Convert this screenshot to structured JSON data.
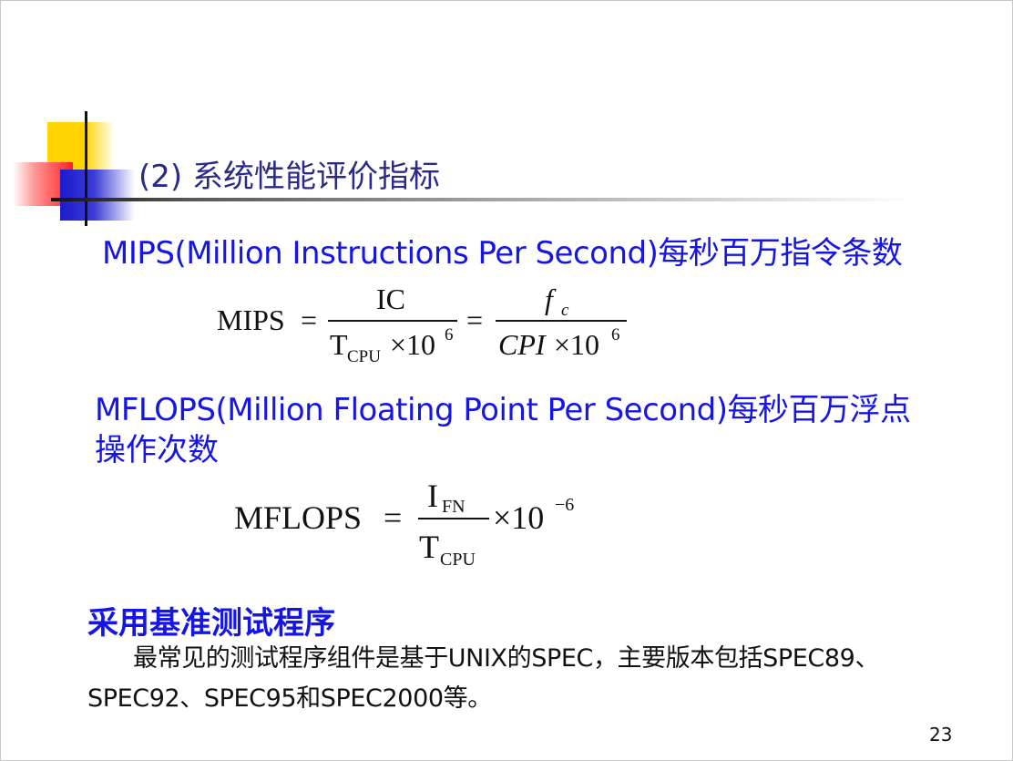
{
  "slide": {
    "title": "(2) 系统性能评价指标",
    "mips_heading": "MIPS(Million Instructions Per Second)每秒百万指令条数",
    "mflops_heading_line1": "MFLOPS(Million Floating Point Per Second)每秒百万浮点",
    "mflops_heading_line2": "操作次数",
    "benchmark_heading": "采用基准测试程序",
    "paragraph_line1": "最常见的测试程序组件是基于UNIX的SPEC，主要版本包括SPEC89、",
    "paragraph_line2": "SPEC92、SPEC95和SPEC2000等。",
    "page_number": "23"
  },
  "formula_mips": {
    "lhs": "MIPS",
    "eq": "=",
    "num1": "IC",
    "den1_T": "T",
    "den1_sub": "CPU",
    "den1_times": "×10",
    "den1_exp": "6",
    "num2_f": "f",
    "num2_sub": "c",
    "den2": "CPI",
    "den2_times": "×10",
    "den2_exp": "6"
  },
  "formula_mflops": {
    "lhs": "MFLOPS",
    "eq": "=",
    "num_I": "I",
    "num_sub": "FN",
    "den_T": "T",
    "den_sub": "CPU",
    "times": "×10",
    "exp": "−6"
  }
}
